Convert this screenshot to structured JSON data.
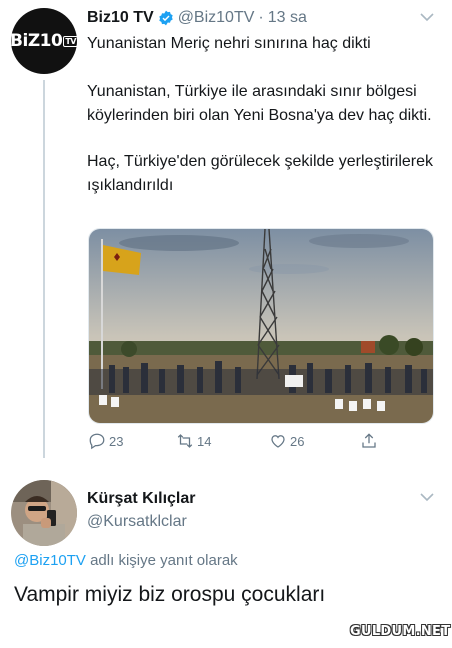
{
  "tweet": {
    "avatar_text": "BiZ10",
    "avatar_badge": "TV",
    "display_name": "Biz10 TV",
    "handle": "@Biz10TV",
    "separator": "·",
    "time": "13 sa",
    "headline": "Yunanistan Meriç nehri sınırına haç dikti",
    "paragraphs": [
      "Yunanistan, Türkiye ile arasındaki sınır bölgesi köylerinden biri olan Yeni Bosna'ya dev haç dikti.",
      "Haç, Türkiye'den görülecek şekilde yerleştirilerek ışıklandırıldı"
    ],
    "actions": {
      "replies": "23",
      "retweets": "14",
      "likes": "26"
    }
  },
  "reply": {
    "display_name": "Kürşat Kılıçlar",
    "handle": "@Kursatklclar",
    "reply_to_mention": "@Biz10TV",
    "reply_to_suffix": " adlı kişiye yanıt olarak",
    "text": "Vampir miyiz biz orospu çocukları"
  },
  "watermark": "GULDUM.NET",
  "icons": [
    "verified-icon",
    "chevron-down-icon",
    "reply-icon",
    "retweet-icon",
    "like-icon",
    "share-icon"
  ],
  "colors": {
    "accent": "#1da1f2",
    "muted": "#657786",
    "text": "#14171a"
  }
}
